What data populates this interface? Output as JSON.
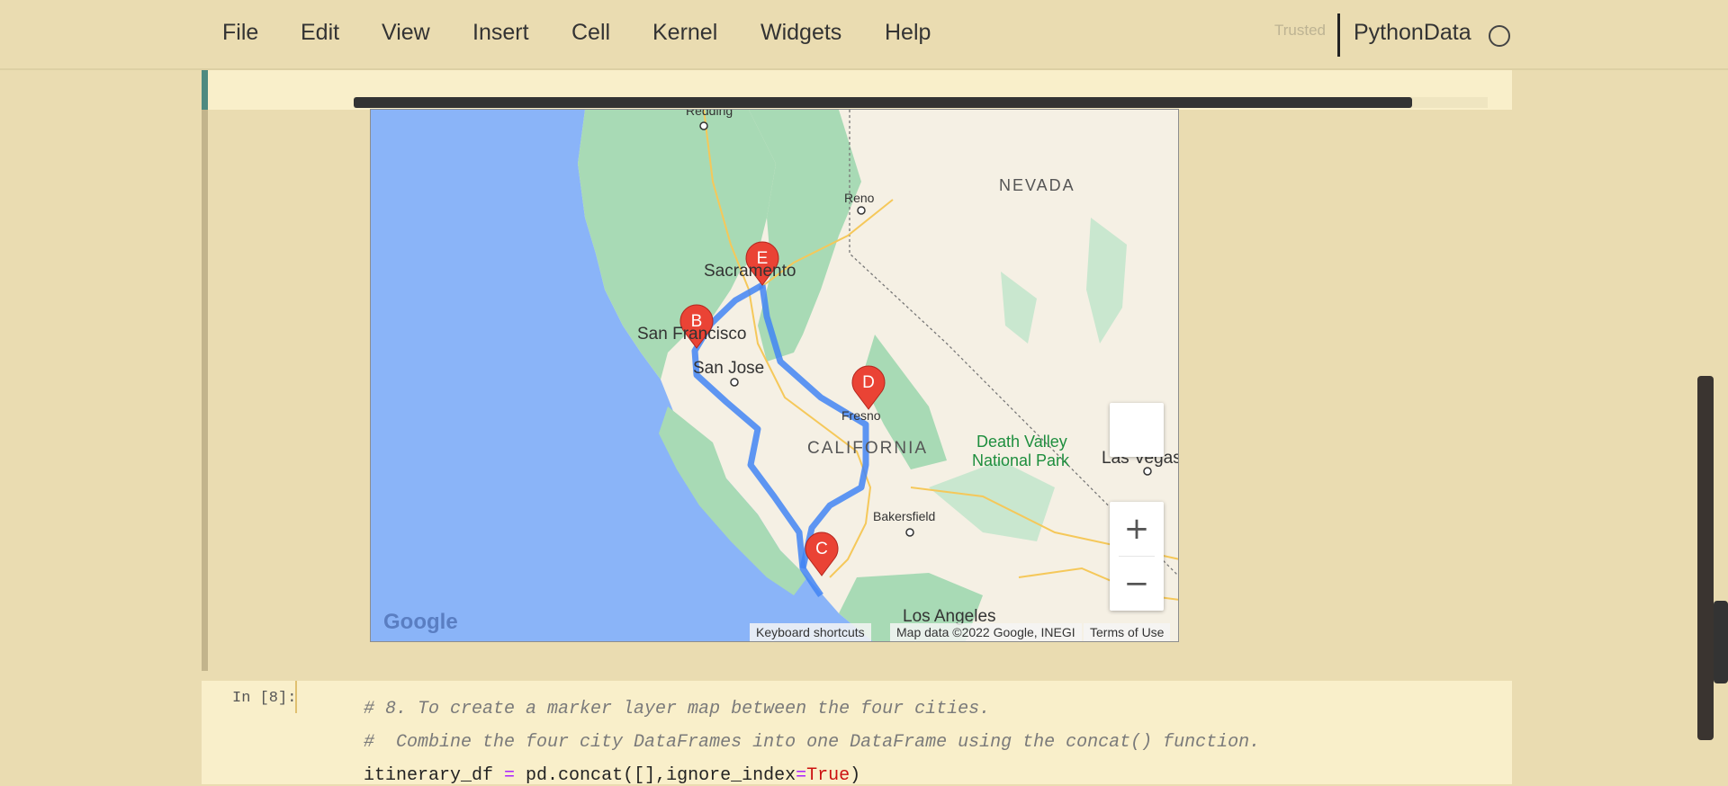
{
  "menu": {
    "items": [
      "File",
      "Edit",
      "View",
      "Insert",
      "Cell",
      "Kernel",
      "Widgets",
      "Help"
    ],
    "trusted": "Trusted",
    "kernel": "PythonData"
  },
  "map": {
    "place_labels": {
      "redding": "Redding",
      "nevada": "NEVADA",
      "reno": "Reno",
      "sacramento": "Sacramento",
      "san_francisco": "San Francisco",
      "san_jose": "San Jose",
      "fresno": "Fresno",
      "california": "CALIFORNIA",
      "death_valley_1": "Death Valley",
      "death_valley_2": "National Park",
      "las_vegas": "Las Vegas",
      "bakersfield": "Bakersfield",
      "los_angeles": "Los Angeles"
    },
    "markers": [
      "B",
      "C",
      "D",
      "E"
    ],
    "controls": {
      "zoom_in": "+",
      "zoom_out": "−"
    },
    "logo": "Google",
    "attribution": {
      "shortcuts": "Keyboard shortcuts",
      "data": "Map data ©2022 Google, INEGI",
      "terms": "Terms of Use"
    },
    "colors": {
      "water": "#8ab4f8",
      "land": "#f5f0e4",
      "forest": "#a8dab5",
      "route": "#4285f4",
      "marker": "#ea4335"
    }
  },
  "cell": {
    "prompt": "In [8]:",
    "line1": "# 8. To create a marker layer map between the four cities.",
    "line2": "#  Combine the four city DataFrames into one DataFrame using the concat() function.",
    "line3_a": "itinerary_df ",
    "line3_op": "=",
    "line3_b": " pd.concat([],ignore_index",
    "line3_op2": "=",
    "line3_kw": "True",
    "line3_c": ")"
  }
}
